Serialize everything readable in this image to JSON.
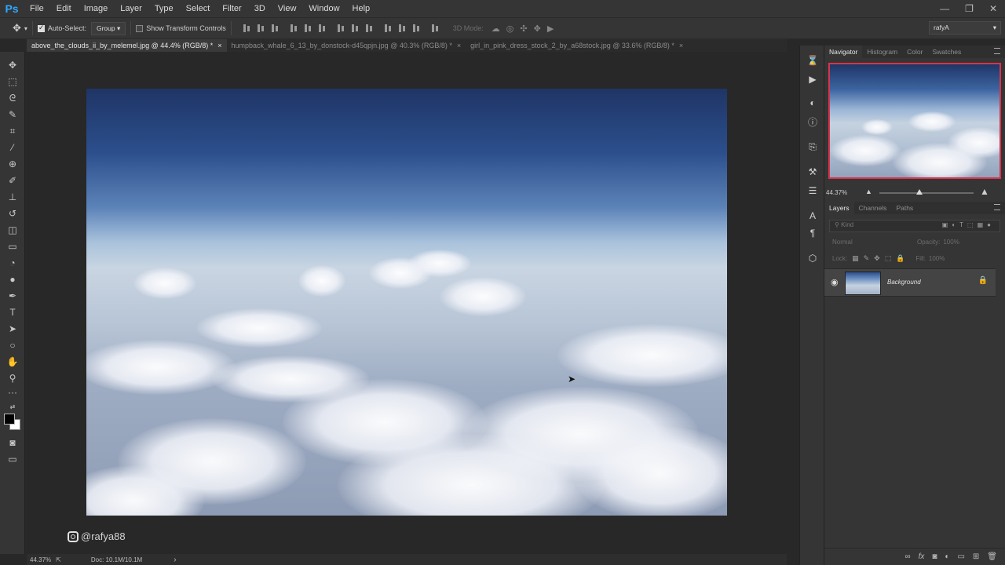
{
  "app": {
    "logo": "Ps"
  },
  "menu": [
    "File",
    "Edit",
    "Image",
    "Layer",
    "Type",
    "Select",
    "Filter",
    "3D",
    "View",
    "Window",
    "Help"
  ],
  "window_controls": {
    "minimize": "—",
    "restore": "❐",
    "close": "✕"
  },
  "options_bar": {
    "auto_select_label": "Auto-Select:",
    "auto_select_checked": true,
    "auto_select_target": "Group",
    "show_transform_label": "Show Transform Controls",
    "show_transform_checked": false,
    "mode_3d_label": "3D Mode:",
    "workspace": "rafyA"
  },
  "tabs": [
    {
      "label": "above_the_clouds_ii_by_melemel.jpg @ 44.4% (RGB/8) *",
      "active": true
    },
    {
      "label": "humpback_whale_6_13_by_donstock-d45qpjn.jpg @ 40.3% (RGB/8) *",
      "active": false
    },
    {
      "label": "girl_in_pink_dress_stock_2_by_a68stock.jpg @ 33.6% (RGB/8) *",
      "active": false
    }
  ],
  "canvas": {
    "watermark": "@rafya88"
  },
  "status": {
    "zoom": "44.37%",
    "doc": "Doc: 10.1M/10.1M",
    "arrow": "›"
  },
  "navigator": {
    "tabs": [
      "Navigator",
      "Histogram",
      "Color",
      "Swatches"
    ],
    "zoom": "44.37%"
  },
  "layers": {
    "tabs": [
      "Layers",
      "Channels",
      "Paths"
    ],
    "filter_placeholder": "Kind",
    "blend_mode": "Normal",
    "opacity_label": "Opacity:",
    "opacity_value": "100%",
    "lock_label": "Lock:",
    "fill_label": "Fill:",
    "fill_value": "100%",
    "items": [
      {
        "name": "Background",
        "visible": true,
        "locked": true
      }
    ],
    "footer_icons": [
      "link-icon",
      "fx-icon",
      "mask-icon",
      "adjustment-icon",
      "group-icon",
      "new-layer-icon",
      "trash-icon"
    ]
  }
}
